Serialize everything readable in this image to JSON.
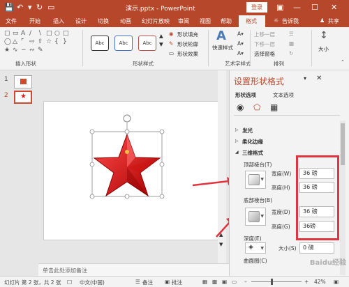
{
  "titlebar": {
    "title": "演示.pptx - PowerPoint",
    "login": "登录",
    "quick_access": [
      "save-icon",
      "undo-icon",
      "redo-icon",
      "present-icon"
    ]
  },
  "tabs": [
    "文件",
    "开始",
    "插入",
    "设计",
    "切换",
    "动画",
    "幻灯片放映",
    "审阅",
    "视图",
    "帮助",
    "格式",
    "告诉我",
    "共享"
  ],
  "active_tab": "格式",
  "ribbon": {
    "insert_shapes_label": "插入形状",
    "shape_styles_label": "形状样式",
    "style_sample": "Abc",
    "shape_fill": "形状填充",
    "shape_outline": "形状轮廓",
    "shape_effects": "形状效果",
    "quick_styles": "快速样式",
    "art_label": "艺术字样式",
    "bring_forward": "上移一层",
    "send_backward": "下移一层",
    "selection_pane": "选择窗格",
    "arrange_label": "排列",
    "size": "大小"
  },
  "thumbs": {
    "n1": "1",
    "n2": "2"
  },
  "notes": "单击此处添加备注",
  "pane": {
    "title": "设置形状格式",
    "tab_shape": "形状选项",
    "tab_text": "文本选项",
    "sections": [
      "发光",
      "柔化边缘",
      "三维格式"
    ],
    "top_bevel": "顶部棱台(T)",
    "bottom_bevel": "底部棱台(B)",
    "width_label": "宽度(W)",
    "height_label": "高度(H)",
    "width_label2": "宽度(D)",
    "height_label2": "高度(G)",
    "top_width": "36 磅",
    "top_height": "36 磅",
    "bottom_width": "36 磅",
    "bottom_height": "36磅",
    "depth": "深度(E)",
    "size_label": "大小(S)",
    "depth_size": "0 磅",
    "contour": "曲面图(C)"
  },
  "statusbar": {
    "slide_info": "幻灯片 第 2 张，共 2 张",
    "lang": "中文(中国)",
    "notes_btn": "备注",
    "comments_btn": "批注",
    "zoom": "42%"
  },
  "watermark": "Baidu经验"
}
